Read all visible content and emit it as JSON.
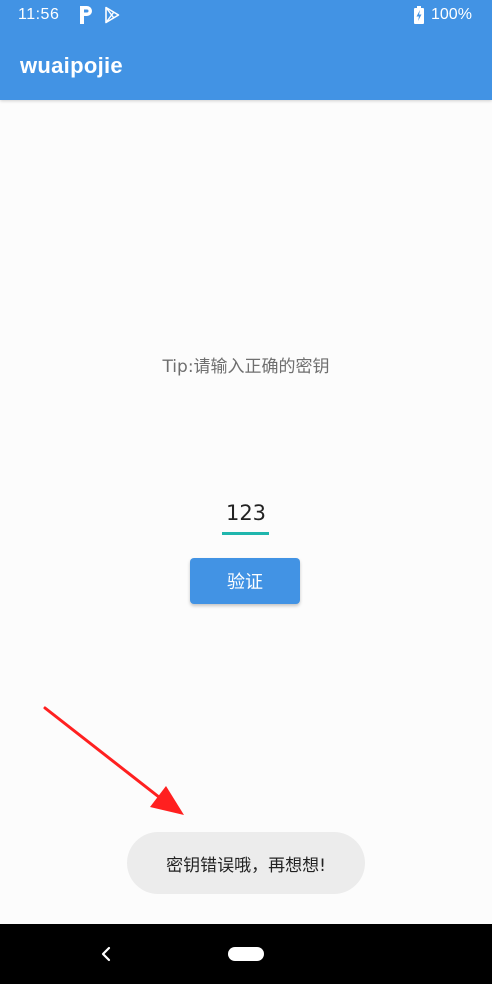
{
  "status_bar": {
    "time": "11:56",
    "battery": "100%"
  },
  "app_bar": {
    "title": "wuaipojie"
  },
  "main": {
    "tip": "Tip:请输入正确的密钥",
    "key_input_value": "123",
    "verify_button": "验证"
  },
  "toast": {
    "message": "密钥错误哦，再想想!"
  },
  "colors": {
    "primary": "#4293e4",
    "accent": "#1fb6ad",
    "annotation_arrow": "#ff2020"
  }
}
